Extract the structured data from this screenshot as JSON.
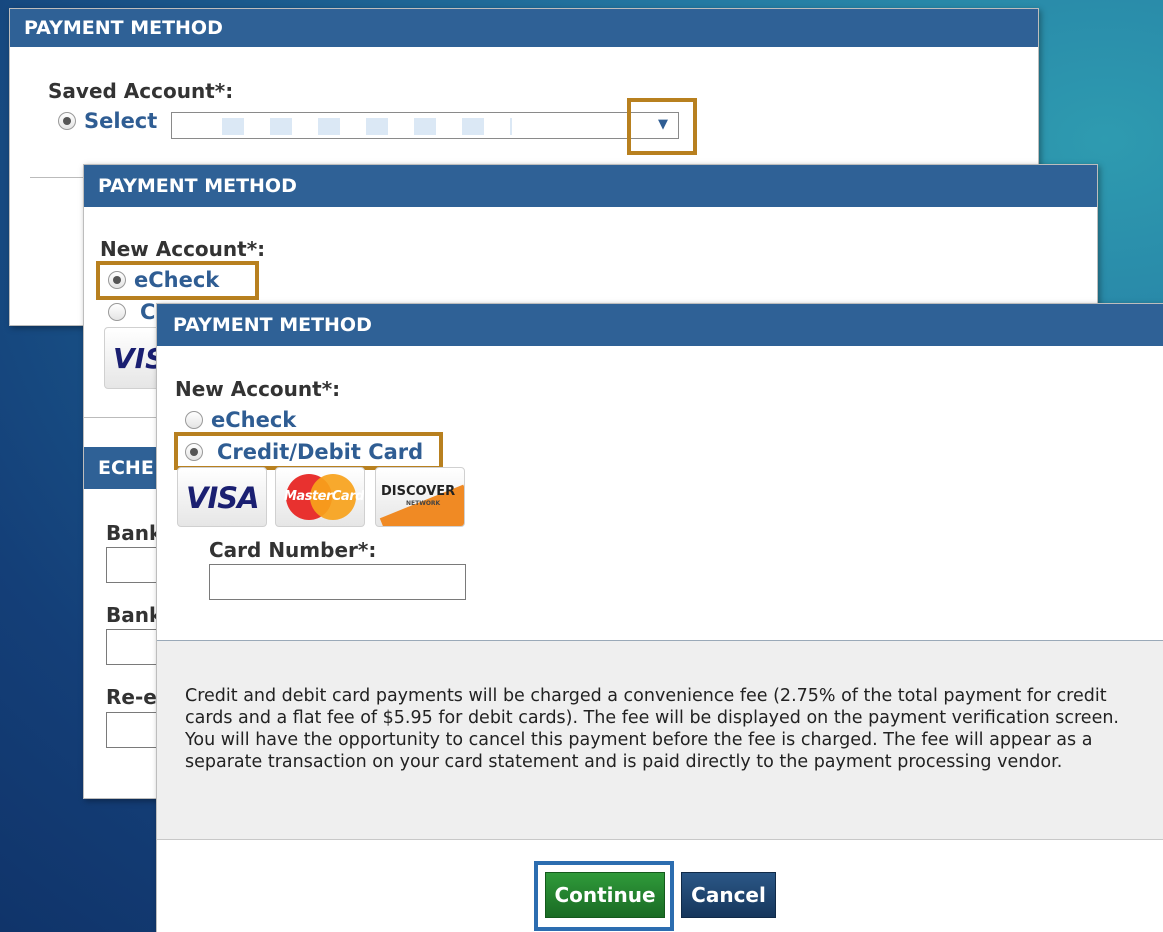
{
  "panel1": {
    "header": "PAYMENT METHOD",
    "saved_account_label": "Saved Account*:",
    "select_label": "Select",
    "dropdown_arrow": "▼"
  },
  "panel2": {
    "header": "PAYMENT METHOD",
    "new_account_label": "New Account*:",
    "echeck_label": "eCheck",
    "card_label_partial": "C",
    "visa_partial": "VIS",
    "echeck_section_partial": "ECHE",
    "bank_label_1": "Bank",
    "bank_label_2": "Bank",
    "reenter_label": "Re-e"
  },
  "panel3": {
    "header": "PAYMENT METHOD",
    "new_account_label": "New Account*:",
    "echeck_label": "eCheck",
    "card_label": "Credit/Debit Card",
    "logos": {
      "visa": "VISA",
      "mastercard": "MasterCard",
      "discover": "DISCOVER",
      "discover_sub": "NETWORK"
    },
    "card_number_label": "Card Number*:",
    "card_number_value": "",
    "fee_notice": "Credit and debit card payments will be charged a convenience fee (2.75% of the total payment for credit cards and a flat fee of $5.95 for debit cards). The fee will be displayed on the payment verification screen. You will have the opportunity to cancel this payment before the fee is charged. The fee will appear as a separate transaction on your card statement and is paid directly to the payment processing vendor.",
    "continue_label": "Continue",
    "cancel_label": "Cancel"
  },
  "colors": {
    "header_blue": "#2f6196",
    "link_blue": "#2f5d93",
    "highlight_gold": "#b8801f",
    "highlight_blue": "#2c6db0",
    "continue_green": "#1f7a2a",
    "cancel_navy": "#1c3f66"
  }
}
